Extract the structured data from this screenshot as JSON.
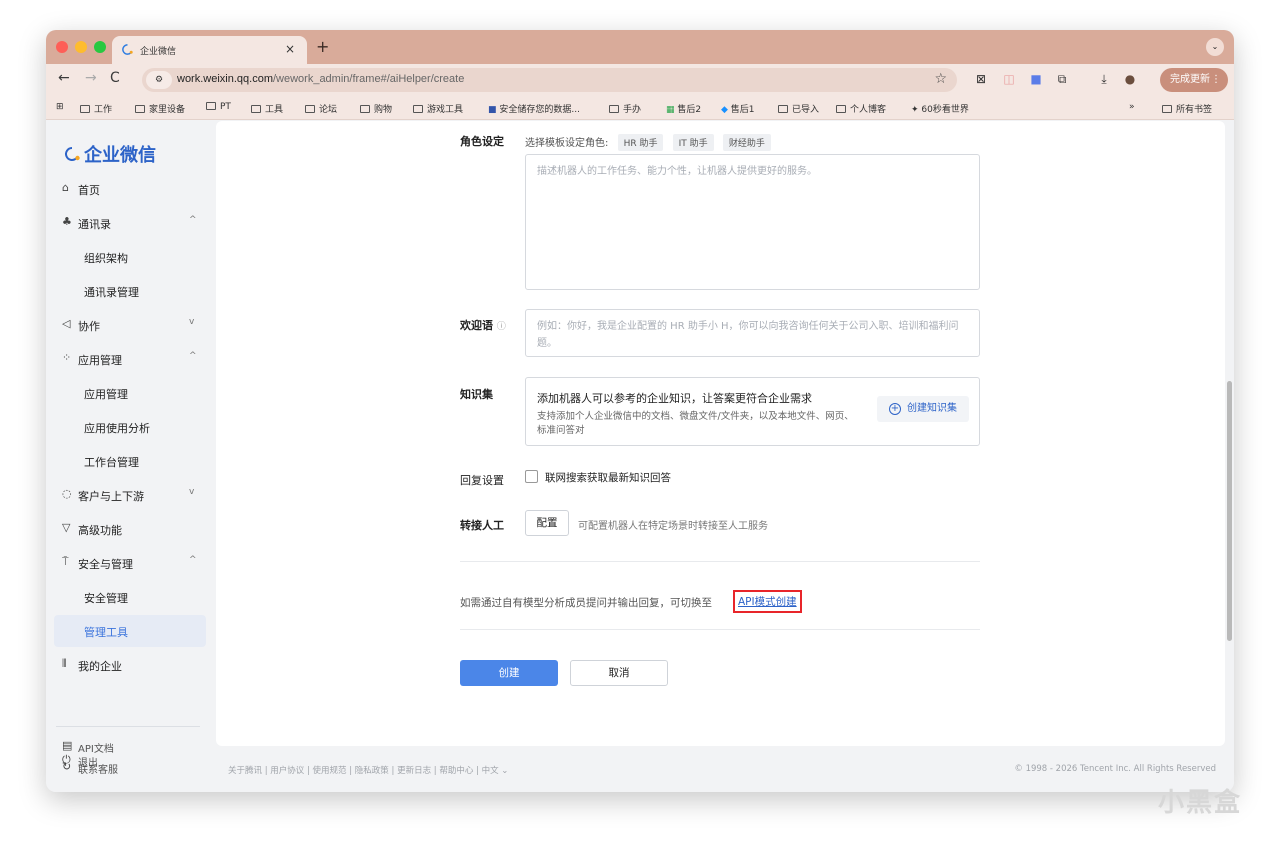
{
  "browser": {
    "tab_title": "企业微信",
    "tab_close": "×",
    "new_tab": "+",
    "url_host": "work.weixin.qq.com",
    "url_path": "/wework_admin/frame#/aiHelper/create",
    "update_button": "完成更新",
    "bookmarks": [
      "工作",
      "家里设备",
      "PT",
      "工具",
      "论坛",
      "购物",
      "游戏工具",
      "安全储存您的数据...",
      "手办",
      "售后2",
      "售后1",
      "已导入",
      "个人博客",
      "60秒看世界"
    ],
    "bookmarks_more": "»",
    "all_bookmarks": "所有书签"
  },
  "sidebar": {
    "logo": "企业微信",
    "items": [
      {
        "label": "首页",
        "icon": "home-icon"
      },
      {
        "label": "通讯录",
        "icon": "org-icon",
        "chevron": "^"
      },
      {
        "label": "组织架构"
      },
      {
        "label": "通讯录管理"
      },
      {
        "label": "协作",
        "icon": "collab-icon",
        "chevron": "v"
      },
      {
        "label": "应用管理",
        "icon": "apps-icon",
        "chevron": "^"
      },
      {
        "label": "应用管理"
      },
      {
        "label": "应用使用分析"
      },
      {
        "label": "工作台管理"
      },
      {
        "label": "客户与上下游",
        "icon": "chat-icon",
        "chevron": "v"
      },
      {
        "label": "高级功能",
        "icon": "advanced-icon"
      },
      {
        "label": "安全与管理",
        "icon": "security-icon",
        "chevron": "^"
      },
      {
        "label": "安全管理"
      },
      {
        "label": "管理工具"
      },
      {
        "label": "我的企业",
        "icon": "enterprise-icon"
      }
    ],
    "bottom": [
      {
        "label": "API文档",
        "icon": "doc-icon"
      },
      {
        "label": "联系客服",
        "icon": "support-icon"
      },
      {
        "label": "退出",
        "icon": "power-icon"
      }
    ]
  },
  "form": {
    "role_label": "角色设定",
    "template_hint": "选择模板设定角色:",
    "templates": [
      "HR 助手",
      "IT 助手",
      "财经助手"
    ],
    "role_placeholder": "描述机器人的工作任务、能力个性，让机器人提供更好的服务。",
    "welcome_label": "欢迎语",
    "welcome_placeholder": "例如：你好，我是企业配置的 HR 助手小 H，你可以向我咨询任何关于公司入职、培训和福利问题。",
    "kb_label": "知识集",
    "kb_title": "添加机器人可以参考的企业知识，让答案更符合企业需求",
    "kb_desc": "支持添加个人企业微信中的文档、微盘文件/文件夹，以及本地文件、网页、标准问答对",
    "kb_button": "创建知识集",
    "reply_label": "回复设置",
    "reply_option": "联网搜索获取最新知识回答",
    "transfer_label": "转接人工",
    "transfer_button": "配置",
    "transfer_hint": "可配置机器人在特定场景时转接至人工服务",
    "api_text": "如需通过自有模型分析成员提问并输出回复，可切换至",
    "api_link": "API模式创建",
    "create_button": "创建",
    "cancel_button": "取消"
  },
  "footer": {
    "links": "关于腾讯 | 用户协议 | 使用规范 | 隐私政策 | 更新日志 | 帮助中心 | 中文 ⌄",
    "copyright": "© 1998 - 2026 Tencent Inc. All Rights Reserved"
  },
  "watermark": "小黑盒"
}
